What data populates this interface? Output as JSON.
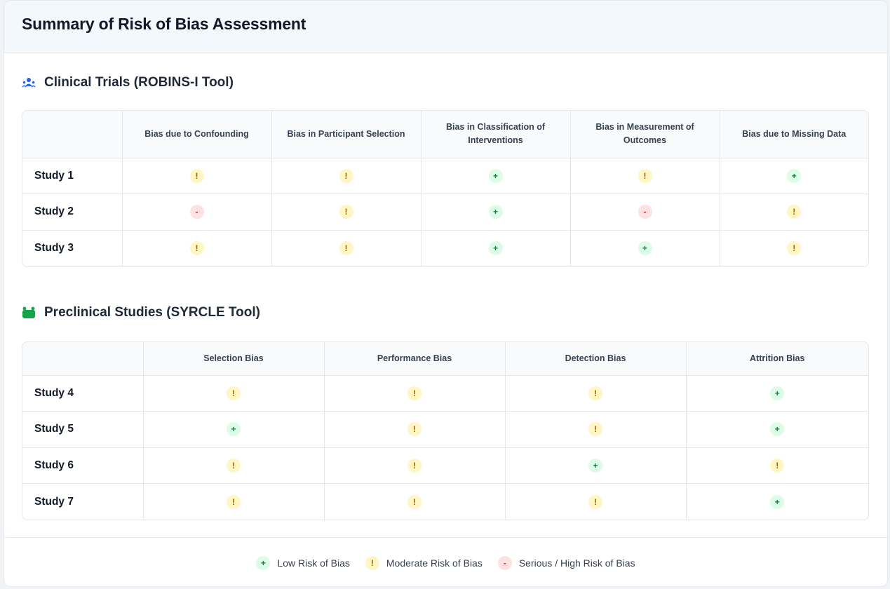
{
  "title": "Summary of Risk of Bias Assessment",
  "sections": [
    {
      "title": "Clinical Trials (ROBINS-I Tool)",
      "icon": "users-icon",
      "icon_color": "#2563eb",
      "columns": [
        "Bias due to Confounding",
        "Bias in Participant Selection",
        "Bias in Classification of Interventions",
        "Bias in Measurement of Outcomes",
        "Bias due to Missing Data"
      ],
      "rows": [
        {
          "study": "Study 1",
          "ratings": [
            "moderate",
            "moderate",
            "low",
            "moderate",
            "low"
          ]
        },
        {
          "study": "Study 2",
          "ratings": [
            "high",
            "moderate",
            "low",
            "high",
            "moderate"
          ]
        },
        {
          "study": "Study 3",
          "ratings": [
            "moderate",
            "moderate",
            "low",
            "low",
            "moderate"
          ]
        }
      ]
    },
    {
      "title": "Preclinical Studies (SYRCLE Tool)",
      "icon": "animal-icon",
      "icon_color": "#16a34a",
      "columns": [
        "Selection Bias",
        "Performance Bias",
        "Detection Bias",
        "Attrition Bias"
      ],
      "rows": [
        {
          "study": "Study 4",
          "ratings": [
            "moderate",
            "moderate",
            "moderate",
            "low"
          ]
        },
        {
          "study": "Study 5",
          "ratings": [
            "low",
            "moderate",
            "moderate",
            "low"
          ]
        },
        {
          "study": "Study 6",
          "ratings": [
            "moderate",
            "moderate",
            "low",
            "moderate"
          ]
        },
        {
          "study": "Study 7",
          "ratings": [
            "moderate",
            "moderate",
            "moderate",
            "low"
          ]
        }
      ]
    }
  ],
  "symbols": {
    "low": "+",
    "moderate": "!",
    "high": "-"
  },
  "legend": [
    {
      "level": "low",
      "label": "Low Risk of Bias"
    },
    {
      "level": "moderate",
      "label": "Moderate Risk of Bias"
    },
    {
      "level": "high",
      "label": "Serious / High Risk of Bias"
    }
  ],
  "colors": {
    "low": "#15803d",
    "moderate": "#a16207",
    "high": "#dc2626"
  }
}
